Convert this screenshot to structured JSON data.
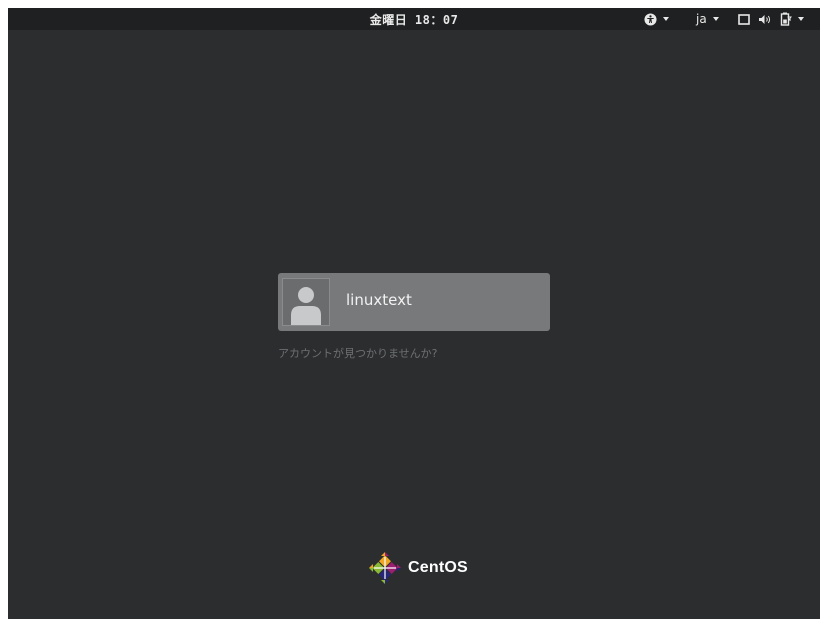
{
  "topbar": {
    "clock": "金曜日 18：07",
    "language": "ja",
    "icons": {
      "accessibility": "accessibility-icon",
      "display": "display-icon",
      "volume": "volume-icon",
      "battery": "battery-icon",
      "dropdown": "chevron-down-icon"
    }
  },
  "login": {
    "users": [
      {
        "name": "linuxtext",
        "avatar": "default-user-avatar-icon"
      }
    ],
    "not_listed_label": "アカウントが見つかりませんか?"
  },
  "branding": {
    "name": "CentOS",
    "logo_colors": [
      "#efa724",
      "#262577",
      "#9c1e70",
      "#8cb934"
    ]
  },
  "colors": {
    "background": "#2b2d2f",
    "topbar": "#1f2021",
    "user_card": "#77797b",
    "text": "#e8e8e8",
    "muted_text": "#6d7072"
  }
}
